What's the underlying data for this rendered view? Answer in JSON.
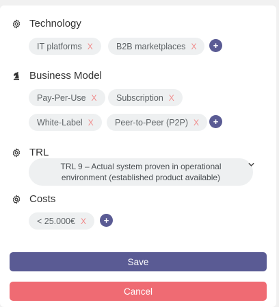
{
  "sections": {
    "technology": {
      "title": "Technology",
      "icon": "gear-icon",
      "chips": [
        "IT platforms",
        "B2B marketplaces"
      ]
    },
    "business_model": {
      "title": "Business Model",
      "icon": "chess-knight-icon",
      "chips": [
        "Pay-Per-Use",
        "Subscription",
        "White-Label",
        "Peer-to-Peer (P2P)"
      ]
    },
    "trl": {
      "title": "TRL",
      "icon": "gear-icon",
      "selected": "TRL 9 – Actual system proven in operational environment (established product available)"
    },
    "costs": {
      "title": "Costs",
      "icon": "gear-icon",
      "chips": [
        "< 25.000€"
      ]
    }
  },
  "chip_remove_glyph": "X",
  "add_glyph": "+",
  "buttons": {
    "save": "Save",
    "cancel": "Cancel"
  },
  "colors": {
    "accent": "#5a5b94",
    "danger": "#ef6b73",
    "chip_bg": "#eef0f1",
    "remove": "#f08a8a"
  }
}
